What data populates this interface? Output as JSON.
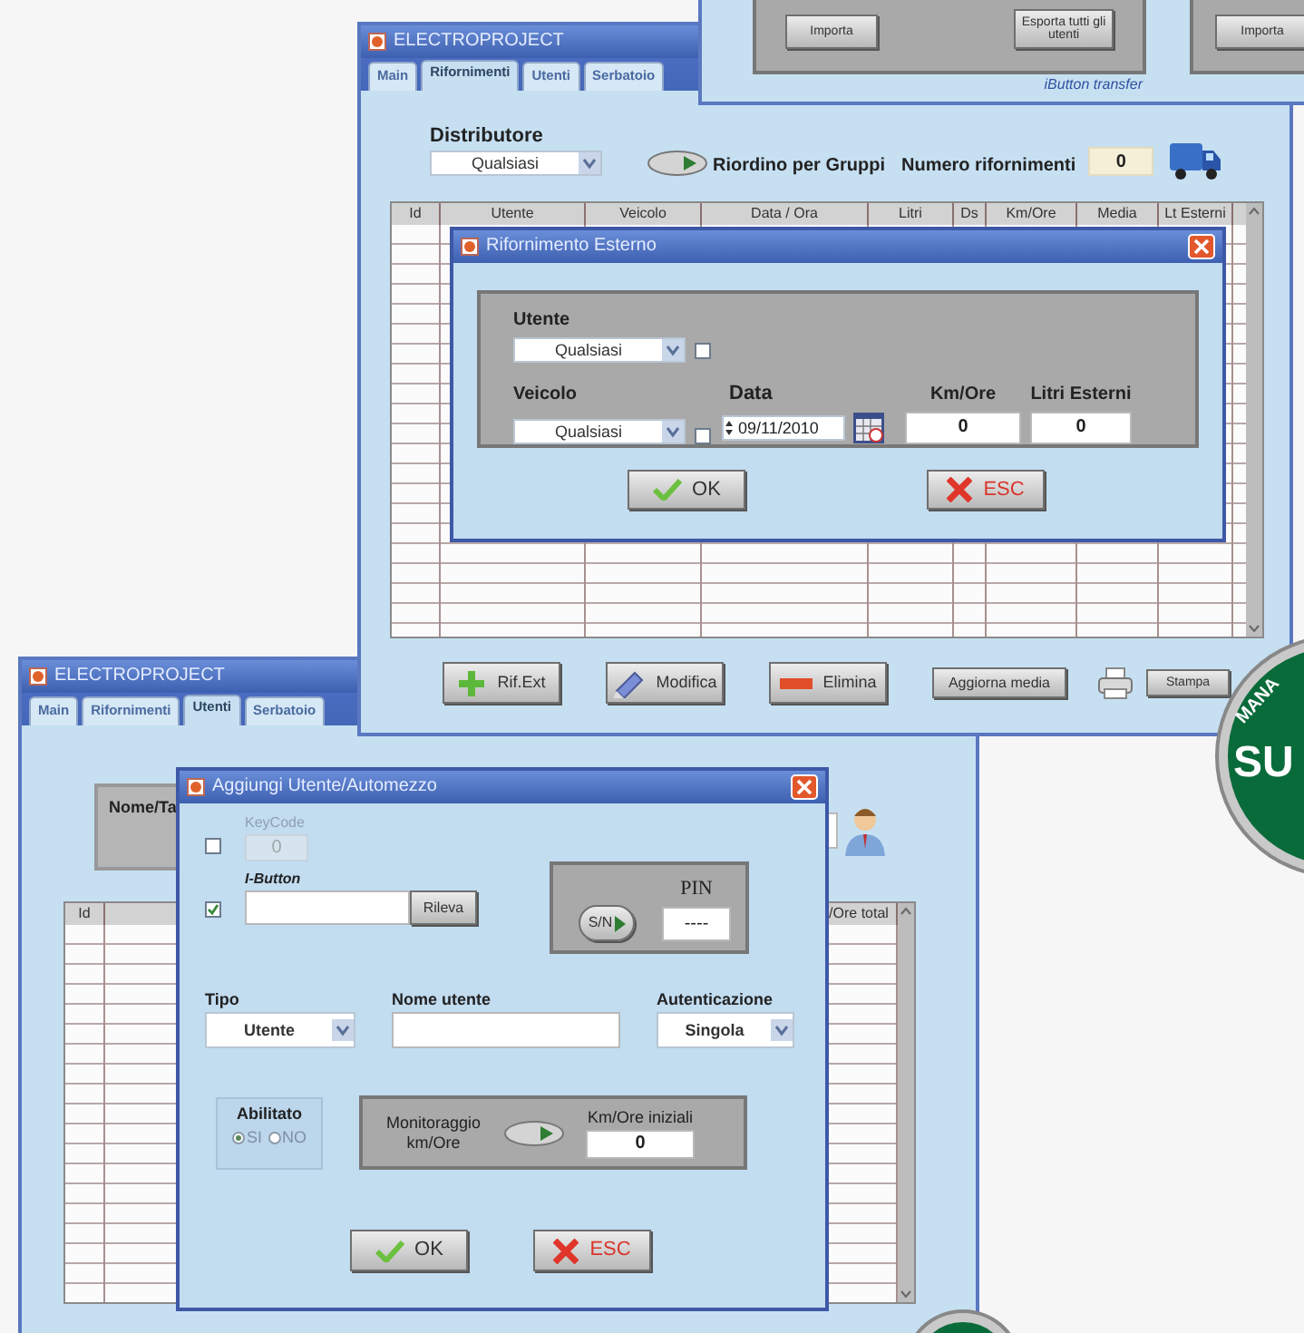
{
  "back_window": {
    "panels": [
      {
        "buttons": [
          "Importa",
          "Esporta tutti gli utenti"
        ]
      },
      {
        "buttons": [
          "Importa"
        ]
      }
    ],
    "caption": "iButton transfer"
  },
  "refuel_window": {
    "title": "ELECTROPROJECT",
    "tabs": [
      {
        "label": "Main",
        "selected": false
      },
      {
        "label": "Rifornimenti",
        "selected": true
      },
      {
        "label": "Utenti",
        "selected": false
      },
      {
        "label": "Serbatoio",
        "selected": false
      }
    ],
    "distributor": {
      "label": "Distributore",
      "value": "Qualsiasi"
    },
    "group_toggle": {
      "label": "Riordino per Gruppi",
      "on": true
    },
    "count": {
      "label": "Numero rifornimenti",
      "value": "0"
    },
    "table": {
      "columns": [
        "Id",
        "Utente",
        "Veicolo",
        "Data / Ora",
        "Litri",
        "Ds",
        "Km/Ore",
        "Media",
        "Lt Esterni"
      ]
    },
    "buttons": [
      {
        "kind": "add",
        "label": "Rif.Ext"
      },
      {
        "kind": "edit",
        "label": "Modifica"
      },
      {
        "kind": "delete",
        "label": "Elimina"
      },
      {
        "kind": "plain",
        "label": "Aggiorna media"
      },
      {
        "kind": "print",
        "label": "Stampa"
      }
    ],
    "dialog": {
      "title": "Rifornimento Esterno",
      "user": {
        "label": "Utente",
        "value": "Qualsiasi",
        "checked": false
      },
      "vehicle": {
        "label": "Veicolo",
        "value": "Qualsiasi",
        "checked": false
      },
      "date": {
        "label": "Data",
        "value": "09/11/2010"
      },
      "km": {
        "label": "Km/Ore",
        "value": "0"
      },
      "external_liters": {
        "label": "Litri Esterni",
        "value": "0"
      },
      "buttons": [
        {
          "kind": "ok",
          "label": "OK"
        },
        {
          "kind": "cancel",
          "label": "ESC"
        }
      ]
    }
  },
  "users_window": {
    "title": "ELECTROPROJECT",
    "tabs": [
      {
        "label": "Main",
        "selected": false
      },
      {
        "label": "Rifornimenti",
        "selected": false
      },
      {
        "label": "Utenti",
        "selected": true
      },
      {
        "label": "Serbatoio",
        "selected": false
      }
    ],
    "name_label": "Nome/Ta",
    "table": {
      "columns": [
        "Id",
        "/Ore total"
      ]
    },
    "dialog": {
      "title": "Aggiungi Utente/Automezzo",
      "id_options": [
        {
          "kind": "keycode",
          "label": "KeyCode",
          "value": "0",
          "checked": false,
          "disabled": true
        },
        {
          "kind": "ibutton",
          "label": "I-Button",
          "button": "Rileva",
          "checked": true,
          "disabled": false
        }
      ],
      "pin": {
        "label": "PIN",
        "toggle": "S/N",
        "value": "----"
      },
      "type": {
        "label": "Tipo",
        "value": "Utente"
      },
      "username": {
        "label": "Nome utente"
      },
      "auth": {
        "label": "Autenticazione",
        "value": "Singola"
      },
      "enabled": {
        "label": "Abilitato",
        "options": [
          {
            "label": "SI",
            "selected": true
          },
          {
            "label": "NO",
            "selected": false
          }
        ]
      },
      "monitoring": {
        "label": "Monitoraggio km/Ore",
        "on": true,
        "initial_label": "Km/Ore iniziali",
        "initial_value": "0"
      },
      "buttons": [
        {
          "kind": "ok",
          "label": "OK"
        },
        {
          "kind": "cancel",
          "label": "ESC"
        }
      ]
    }
  },
  "badge": {
    "top": "MANA",
    "main": "SU"
  }
}
